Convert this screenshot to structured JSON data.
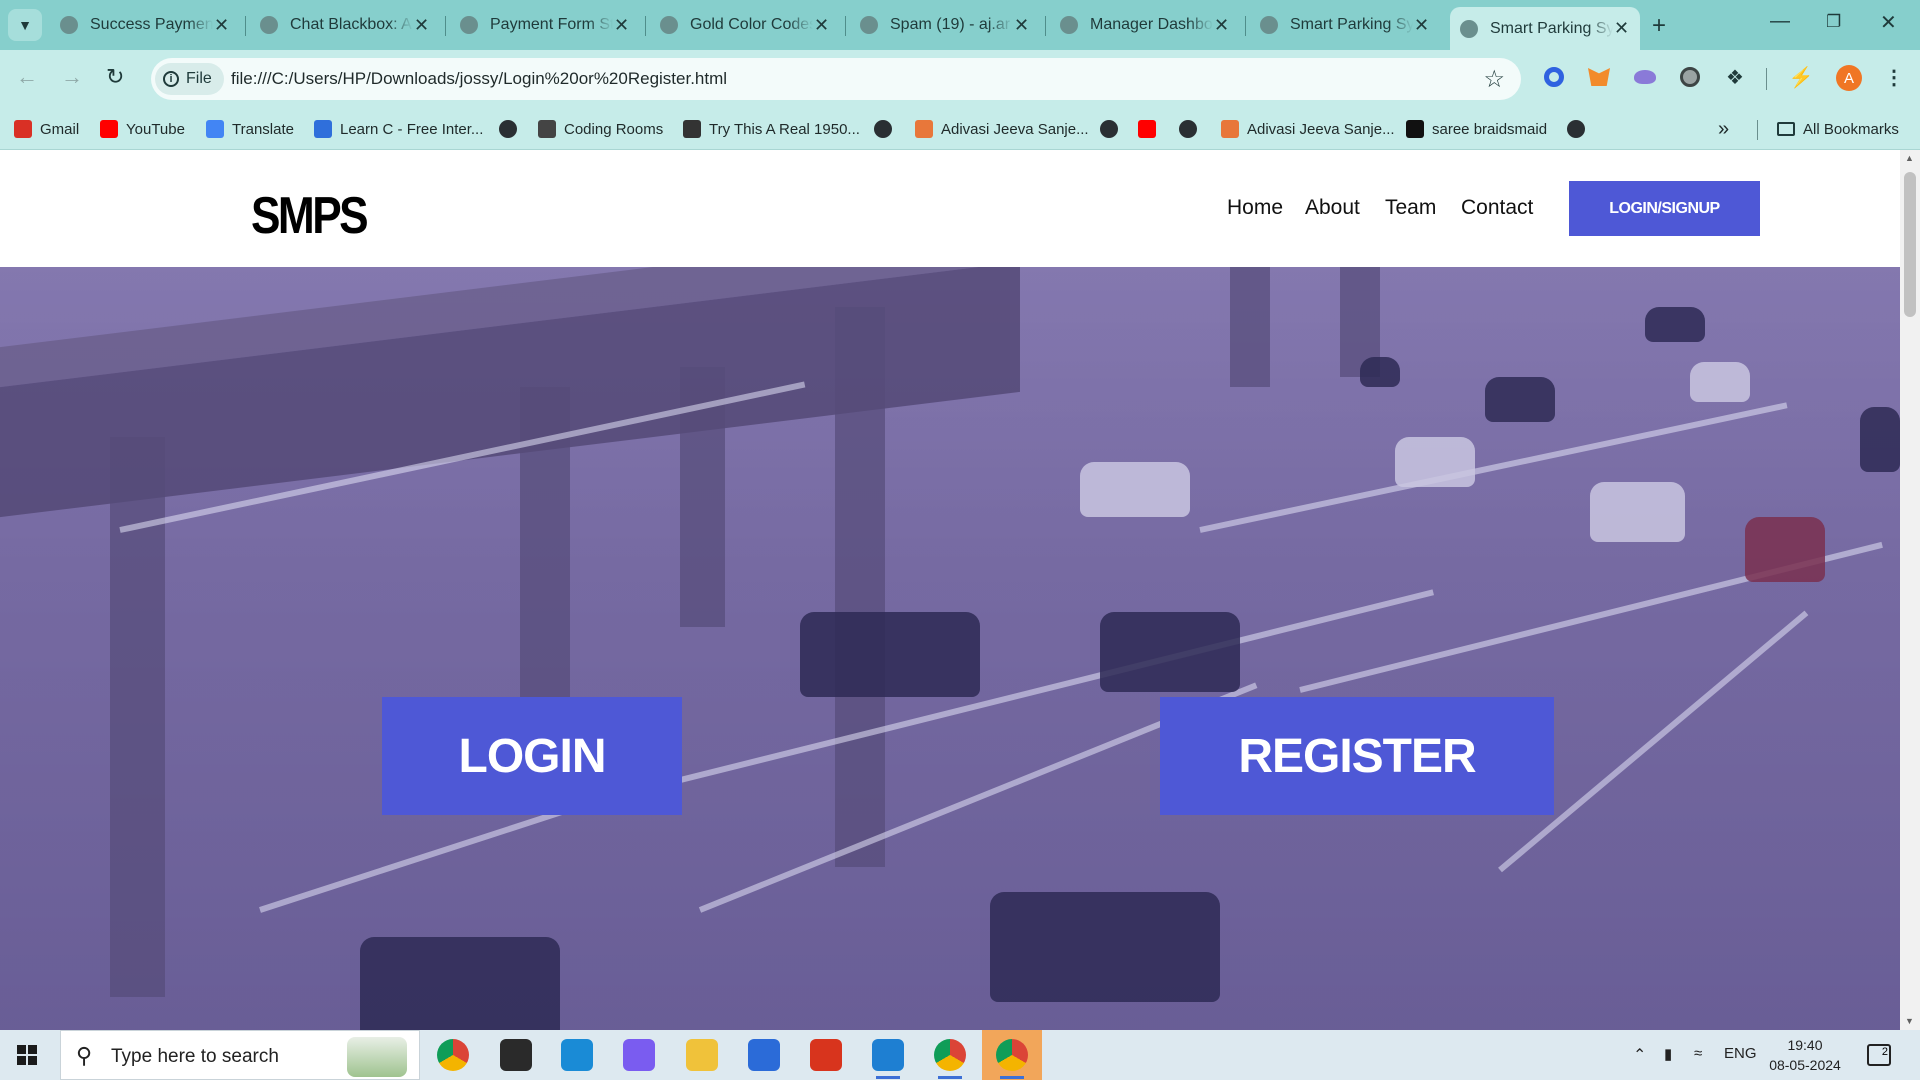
{
  "browser": {
    "tabs": [
      {
        "title": "Success Payment",
        "active": false
      },
      {
        "title": "Chat Blackbox: AI",
        "active": false
      },
      {
        "title": "Payment Form Sty",
        "active": false
      },
      {
        "title": "Gold Color Codes",
        "active": false
      },
      {
        "title": "Spam (19) - aj.ar",
        "active": false
      },
      {
        "title": "Manager Dashbo",
        "active": false
      },
      {
        "title": "Smart Parking Sys",
        "active": false
      },
      {
        "title": "Smart Parking Sys",
        "active": true
      }
    ],
    "address": {
      "chip_label": "File",
      "url": "file:///C:/Users/HP/Downloads/jossy/Login%20or%20Register.html"
    },
    "profile_initial": "A",
    "bookmarks": [
      {
        "label": "Gmail",
        "icon": "gmail-icon",
        "color": "#d93025"
      },
      {
        "label": "YouTube",
        "icon": "youtube-icon",
        "color": "#ff0000"
      },
      {
        "label": "Translate",
        "icon": "translate-icon",
        "color": "#4285f4"
      },
      {
        "label": "Learn C - Free Inter...",
        "icon": "learn-c-icon",
        "color": "#2f6fdb"
      },
      {
        "label": "",
        "icon": "globe-icon",
        "color": "#2a2f33"
      },
      {
        "label": "Coding Rooms",
        "icon": "coding-rooms-icon",
        "color": "#444444"
      },
      {
        "label": "Try This A Real 1950...",
        "icon": "bookmark-site-icon",
        "color": "#333333"
      },
      {
        "label": "",
        "icon": "globe-icon",
        "color": "#2a2f33"
      },
      {
        "label": "Adivasi Jeeva Sanje...",
        "icon": "adivasi-icon",
        "color": "#e8773a"
      },
      {
        "label": "",
        "icon": "globe-icon",
        "color": "#2a2f33"
      },
      {
        "label": "",
        "icon": "youtube-icon",
        "color": "#ff0000"
      },
      {
        "label": "",
        "icon": "globe-icon",
        "color": "#2a2f33"
      },
      {
        "label": "Adivasi Jeeva Sanje...",
        "icon": "adivasi-icon",
        "color": "#e8773a"
      },
      {
        "label": "saree braidsmaid",
        "icon": "saree-icon",
        "color": "#111111"
      },
      {
        "label": "",
        "icon": "globe-icon",
        "color": "#2a2f33"
      }
    ],
    "all_bookmarks_label": "All Bookmarks",
    "theme_colors": {
      "tabstrip": "#86cfcc",
      "toolbar": "#c6ece9"
    }
  },
  "site": {
    "logo": "SMPS",
    "nav": [
      "Home",
      "About",
      "Team",
      "Contact"
    ],
    "cta_label": "LOGIN/SIGNUP",
    "hero": {
      "login_label": "LOGIN",
      "register_label": "REGISTER"
    },
    "accent_color": "#4e58d6"
  },
  "taskbar": {
    "search_placeholder": "Type here to search",
    "apps": [
      {
        "name": "chrome-icon",
        "color": "#ffffff"
      },
      {
        "name": "cyberlink-icon",
        "color": "#2a2a2a"
      },
      {
        "name": "edge-icon",
        "color": "#1a8bd6"
      },
      {
        "name": "copilot-icon",
        "color": "#7a5cf0"
      },
      {
        "name": "file-explorer-icon",
        "color": "#f0c23a"
      },
      {
        "name": "mail-icon",
        "color": "#2b6bd8"
      },
      {
        "name": "office-icon",
        "color": "#d8341d"
      },
      {
        "name": "vscode-icon",
        "color": "#1e7fd2"
      },
      {
        "name": "chrome-profile-icon",
        "color": "#ffffff"
      },
      {
        "name": "chrome-notification-icon",
        "color": "#d03c86"
      }
    ],
    "language": "ENG",
    "time": "19:40",
    "date": "08-05-2024",
    "notification_count": "2"
  }
}
